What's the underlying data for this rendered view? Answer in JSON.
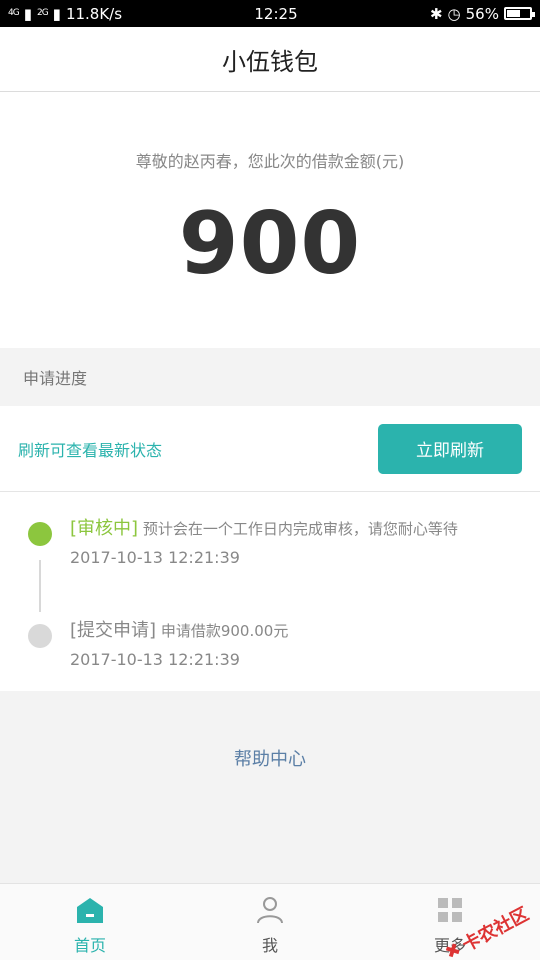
{
  "status": {
    "carrier1": "4G",
    "carrier2": "2G",
    "speed": "11.8K/s",
    "time": "12:25",
    "battery": "56%",
    "battery_fraction": 0.56
  },
  "header": {
    "title": "小伍钱包"
  },
  "loan": {
    "greeting": "尊敬的赵丙春，您此次的借款金额(元)",
    "amount": "900"
  },
  "progress": {
    "section_title": "申请进度",
    "refresh_hint": "刷新可查看最新状态",
    "refresh_button": "立即刷新",
    "items": [
      {
        "tag": "[审核中]",
        "desc": "预计会在一个工作日内完成审核，请您耐心等待",
        "time": "2017-10-13 12:21:39",
        "color": "#8cc63e",
        "tag_color": "#8cc63e"
      },
      {
        "tag": "[提交申请]",
        "desc": "申请借款900.00元",
        "time": "2017-10-13 12:21:39",
        "color": "#d9d9d9",
        "tag_color": "#888888"
      }
    ]
  },
  "help": {
    "label": "帮助中心"
  },
  "tabs": [
    {
      "label": "首页",
      "icon": "home-icon",
      "active": true
    },
    {
      "label": "我",
      "icon": "user-icon",
      "active": false
    },
    {
      "label": "更多",
      "icon": "more-icon",
      "active": false
    }
  ],
  "watermark": {
    "text": "卡农社区"
  },
  "colors": {
    "accent": "#2bb3ad",
    "link": "#5b7fa6",
    "success": "#8cc63e"
  }
}
